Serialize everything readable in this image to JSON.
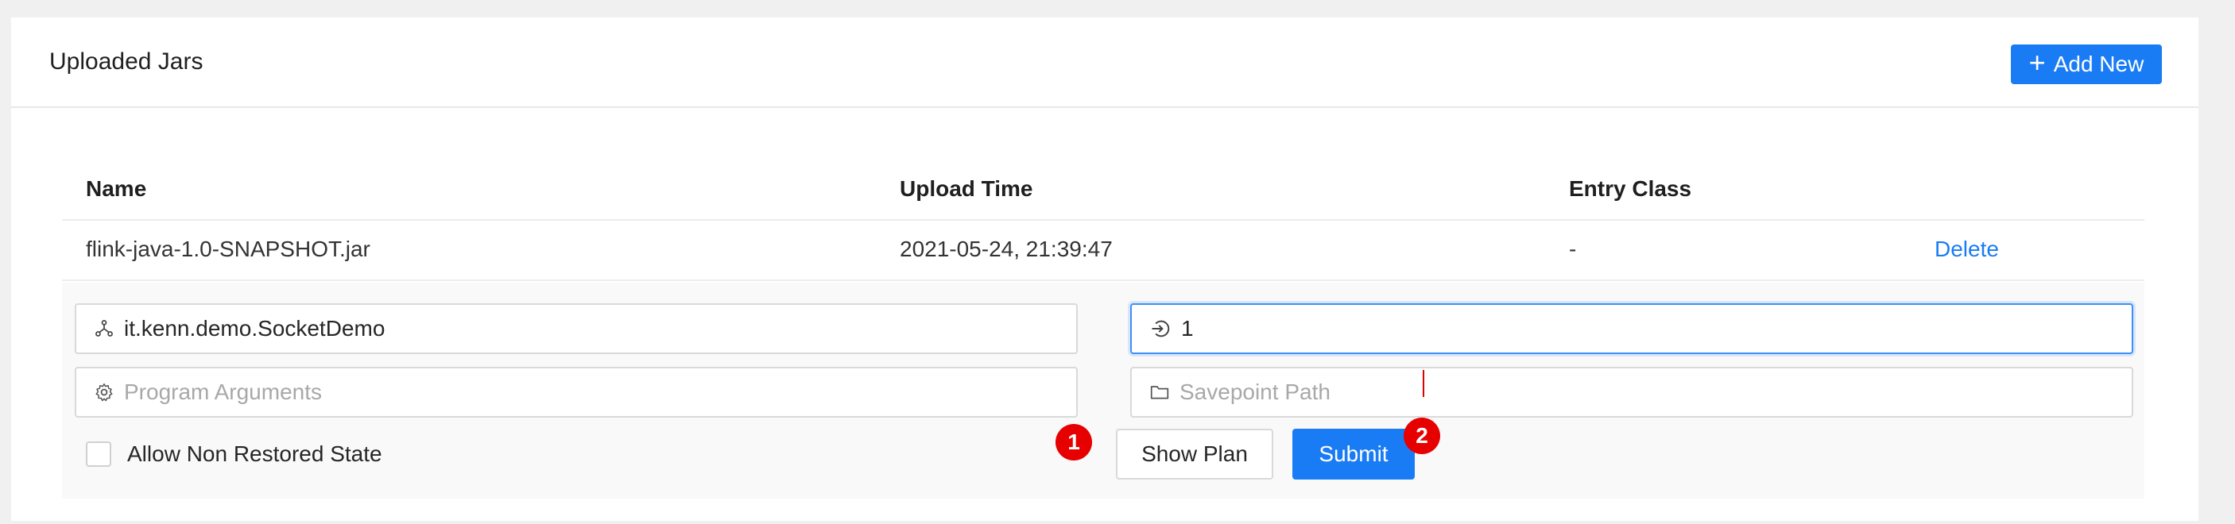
{
  "header": {
    "title": "Uploaded Jars",
    "add_button_label": "Add New",
    "add_icon": "plus-icon"
  },
  "table": {
    "columns": [
      "Name",
      "Upload Time",
      "Entry Class"
    ],
    "rows": [
      {
        "name": "flink-java-1.0-SNAPSHOT.jar",
        "upload_time": "2021-05-24, 21:39:47",
        "entry_class": "-",
        "action": "Delete"
      }
    ]
  },
  "form": {
    "entry_class_value": "it.kenn.demo.SocketDemo",
    "entry_class_icon": "cluster-icon",
    "parallelism_value": "1",
    "parallelism_icon": "login-icon",
    "program_args_placeholder": "Program Arguments",
    "program_args_icon": "gear-icon",
    "savepoint_placeholder": "Savepoint Path",
    "savepoint_icon": "folder-icon",
    "allow_non_restored_label": "Allow Non Restored State",
    "show_plan_label": "Show Plan",
    "submit_label": "Submit"
  },
  "markers": [
    "1",
    "2"
  ],
  "colors": {
    "primary": "#1a7cf4",
    "marker": "#e60000",
    "link": "#1a7cf4"
  }
}
